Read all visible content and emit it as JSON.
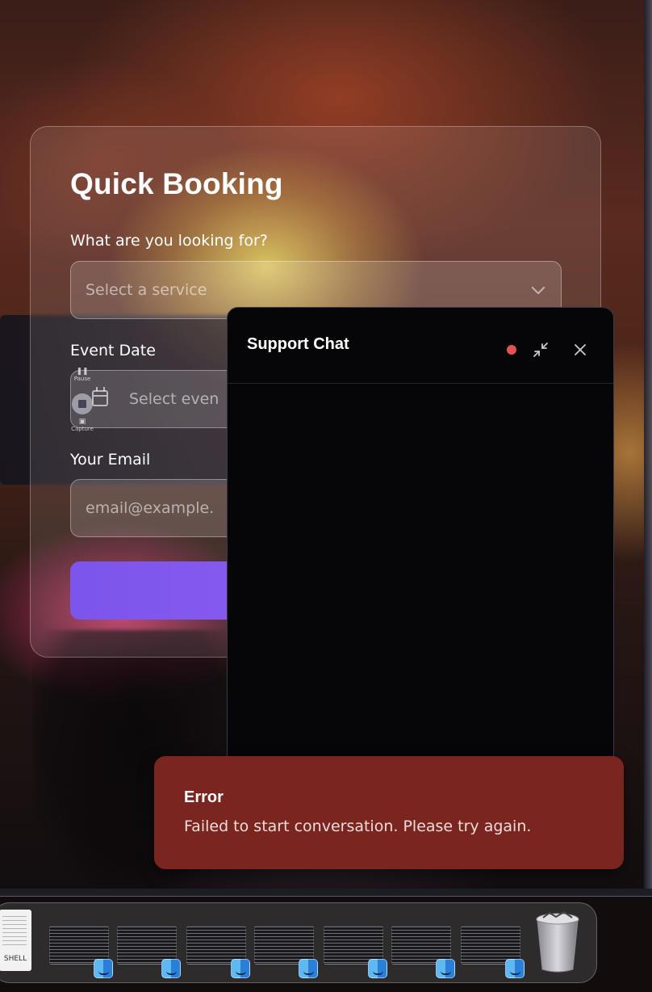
{
  "booking": {
    "title": "Quick Booking",
    "service_label": "What are you looking for?",
    "service_placeholder": "Select a service",
    "date_label": "Event Date",
    "date_placeholder": "Select even",
    "email_label": "Your Email",
    "email_placeholder": "email@example."
  },
  "chat": {
    "title": "Support Chat",
    "status_color": "#e25252"
  },
  "toast": {
    "title": "Error",
    "message": "Failed to start conversation. Please try again."
  },
  "recorder": {
    "pause_label": "Pause",
    "capture_label": "Capture"
  },
  "dock": {
    "shell_label": "SHELL",
    "items": [
      "window-thumbnail",
      "window-thumbnail",
      "window-thumbnail",
      "window-thumbnail",
      "window-thumbnail",
      "window-thumbnail",
      "window-thumbnail"
    ],
    "trash": "trash-icon"
  },
  "colors": {
    "accent": "#8b5cf6",
    "toast_bg": "#7a2520",
    "chat_bg": "#060608"
  }
}
